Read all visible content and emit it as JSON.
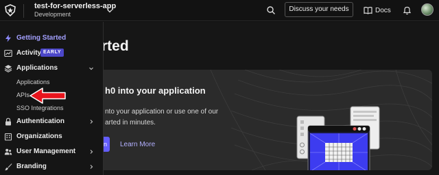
{
  "topbar": {
    "logo_icon": "auth0-shield-icon",
    "tenant_name": "test-for-serverless-app",
    "tenant_env": "Development",
    "discuss_label": "Discuss your needs",
    "docs_label": "Docs"
  },
  "sidebar": {
    "getting_started": "Getting Started",
    "activity": "Activity",
    "activity_badge": "EARLY",
    "applications": "Applications",
    "applications_sub": "Applications",
    "apis": "APIs",
    "sso": "SSO Integrations",
    "authentication": "Authentication",
    "organizations": "Organizations",
    "user_management": "User Management",
    "branding": "Branding"
  },
  "main": {
    "title_visible": "rted",
    "card_title_visible": "h0 into your application",
    "card_desc_line1": "nto your application or use one of our",
    "card_desc_line2": "arted in minutes.",
    "primary_button_visible": "n",
    "learn_more": "Learn More"
  },
  "colors": {
    "accent": "#635dff",
    "active_text": "#a3a0ff",
    "annotation_arrow": "#e8141c"
  }
}
